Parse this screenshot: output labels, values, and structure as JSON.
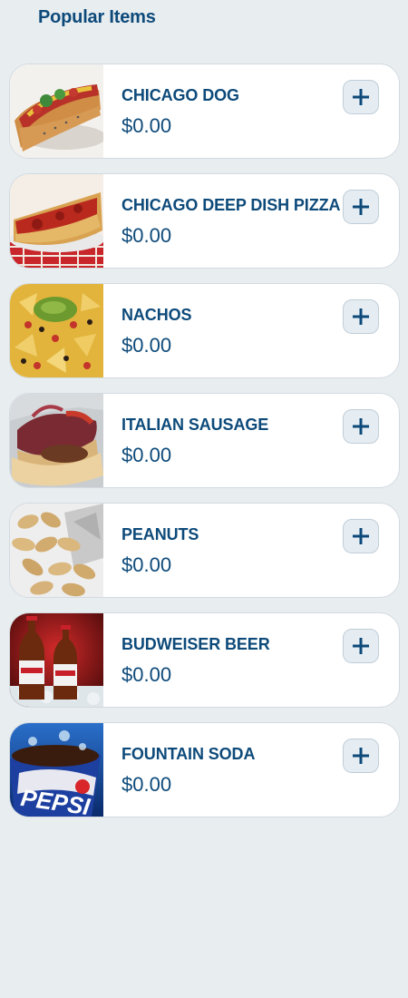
{
  "header": {
    "title": "Popular Items"
  },
  "items": [
    {
      "name": "CHICAGO DOG",
      "price": "$0.00",
      "image": "hot-dog-image"
    },
    {
      "name": "CHICAGO DEEP DISH PIZZA",
      "price": "$0.00",
      "image": "deep-dish-pizza-image"
    },
    {
      "name": "NACHOS",
      "price": "$0.00",
      "image": "nachos-image"
    },
    {
      "name": "ITALIAN SAUSAGE",
      "price": "$0.00",
      "image": "italian-sausage-image"
    },
    {
      "name": "PEANUTS",
      "price": "$0.00",
      "image": "peanuts-image"
    },
    {
      "name": "BUDWEISER BEER",
      "price": "$0.00",
      "image": "beer-bottles-image"
    },
    {
      "name": "FOUNTAIN SODA",
      "price": "$0.00",
      "image": "soda-cup-image"
    }
  ],
  "icons": {
    "add": "plus-icon"
  },
  "colors": {
    "accent": "#0d4a7a",
    "background": "#e8edf0",
    "card": "#ffffff",
    "button_bg": "#e6edf2"
  }
}
